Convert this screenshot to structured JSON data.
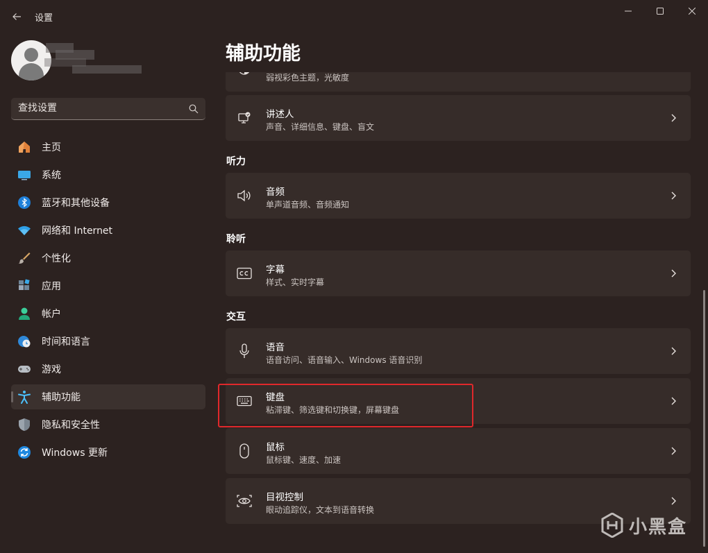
{
  "app": {
    "title": "设置",
    "window_controls": [
      "minimize",
      "maximize",
      "close"
    ]
  },
  "search": {
    "placeholder": "查找设置"
  },
  "sidebar": {
    "items": [
      {
        "label": "主页",
        "icon": "home-icon",
        "active": false
      },
      {
        "label": "系统",
        "icon": "monitor-icon",
        "active": false
      },
      {
        "label": "蓝牙和其他设备",
        "icon": "bluetooth-icon",
        "active": false
      },
      {
        "label": "网络和 Internet",
        "icon": "wifi-icon",
        "active": false
      },
      {
        "label": "个性化",
        "icon": "paintbrush-icon",
        "active": false
      },
      {
        "label": "应用",
        "icon": "apps-icon",
        "active": false
      },
      {
        "label": "帐户",
        "icon": "account-icon",
        "active": false
      },
      {
        "label": "时间和语言",
        "icon": "globe-clock-icon",
        "active": false
      },
      {
        "label": "游戏",
        "icon": "gamepad-icon",
        "active": false
      },
      {
        "label": "辅助功能",
        "icon": "accessibility-icon",
        "active": true
      },
      {
        "label": "隐私和安全性",
        "icon": "shield-icon",
        "active": false
      },
      {
        "label": "Windows 更新",
        "icon": "update-icon",
        "active": false
      }
    ]
  },
  "main": {
    "title": "辅助功能",
    "partial_card_sub": "弱视彩色主题，光敏度",
    "narrator": {
      "title": "讲述人",
      "sub": "声音、详细信息、键盘、盲文"
    },
    "sections": {
      "hearing": "听力",
      "listening": "聆听",
      "interaction": "交互"
    },
    "audio": {
      "title": "音频",
      "sub": "单声道音频、音频通知"
    },
    "captions": {
      "title": "字幕",
      "sub": "样式、实时字幕"
    },
    "speech": {
      "title": "语音",
      "sub": "语音访问、语音输入、Windows 语音识别"
    },
    "keyboard": {
      "title": "键盘",
      "sub": "粘滞键、筛选键和切换键，屏幕键盘"
    },
    "mouse": {
      "title": "鼠标",
      "sub": "鼠标键、速度、加速"
    },
    "eye_control": {
      "title": "目视控制",
      "sub": "眼动追踪仪，文本到语音转换"
    }
  },
  "watermark": {
    "text": "小黑盒"
  },
  "colors": {
    "background": "#2c2220",
    "card": "#362c29",
    "highlight_border": "#e0282b",
    "accent_blue": "#4cc2ff"
  }
}
